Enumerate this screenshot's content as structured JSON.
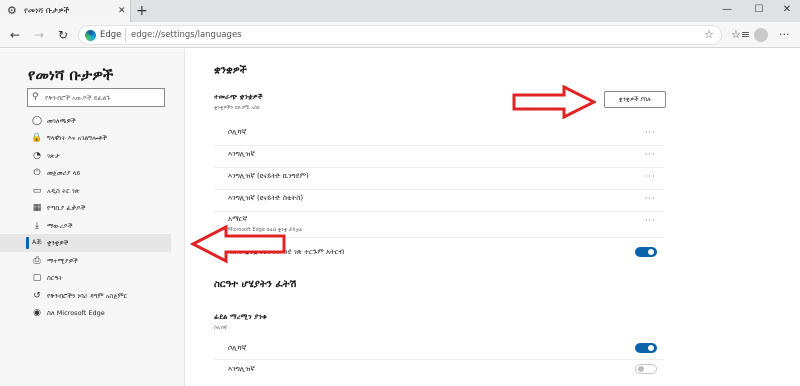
{
  "browser": {
    "tab_title": "የመነሻ ቡታዎች",
    "tab_close_icon": "close-icon",
    "new_tab": "+",
    "window_controls": {
      "minimize": "—",
      "maximize": "☐",
      "close": "✕"
    },
    "nav": {
      "back": "←",
      "forward": "→",
      "refresh": "↻"
    },
    "address_brand": "Edge",
    "address_url": "edge://settings/languages",
    "favorite_icon": "☆",
    "collections_icon": "☆≡",
    "menu_icon": "···"
  },
  "sidebar": {
    "title": "የመነሻ ቡታዎች",
    "search_placeholder": "የቅንብሮች አውዶች ይፈልጉ",
    "items": [
      {
        "icon": "profile-icon",
        "glyph": "◯",
        "label": "መገለጫዎች"
      },
      {
        "icon": "lock-icon",
        "glyph": "🔒",
        "label": "ግላዊነት እና አገልግሎቶች"
      },
      {
        "icon": "appearance-icon",
        "glyph": "◔",
        "label": "ገጽታ"
      },
      {
        "icon": "power-icon",
        "glyph": "⏻",
        "label": "መጀመሪያ ላይ"
      },
      {
        "icon": "newtab-icon",
        "glyph": "▭",
        "label": "አዲስ ትር ገጽ"
      },
      {
        "icon": "site-permissions-icon",
        "glyph": "▦",
        "label": "የጣቢያ ፈቃዶች"
      },
      {
        "icon": "download-icon",
        "glyph": "⤓",
        "label": "ማውረዶች"
      },
      {
        "icon": "languages-icon",
        "glyph": "Aあ",
        "label": "ቋንቋዎች"
      },
      {
        "icon": "printer-icon",
        "glyph": "⎙",
        "label": "ማተሚያዎች"
      },
      {
        "icon": "system-icon",
        "glyph": "▢",
        "label": "ስርዓት"
      },
      {
        "icon": "reset-icon",
        "glyph": "↺",
        "label": "የቅንብሮችን ነባሪ ዳግም አስጀምር"
      },
      {
        "icon": "edge-icon",
        "glyph": "◉",
        "label": "ስለ Microsoft Edge"
      }
    ],
    "selected_index": 7
  },
  "main": {
    "languages_heading": "ቋንቋዎች",
    "preferred_label": "ተመራጭ ቋንቋዎች",
    "preferred_sub": "ቋንቋዎችን በድጋሚ አስከ",
    "add_button": "ቋንቋዎች ያክሉ",
    "languages": [
      {
        "name": "ሶሊሻኛ"
      },
      {
        "name": "እንግሊዝኛ"
      },
      {
        "name": "እንግሊዝኛ (ዩናይትድ ኪንግደም)"
      },
      {
        "name": "እንግሊዝኛ (ዩናይትድ ስቴትስ)"
      },
      {
        "name": "አማርኛ"
      }
    ],
    "amharic_sub": "Microsoft Edge በዚህ ቋንቋ ታይቷል",
    "translate_label": "በምታነቡት ቋንቋ የሆኑትን ወደ ገጽ ተርጉም አትርብ",
    "translate_on": true,
    "spellcheck_heading": "ስርዓተ ሆሄያትን ፈትሽ",
    "spellcheck_label": "ፊደል ማረሚን ያንቁ",
    "spellcheck_sub": "ሶሊሻኛ",
    "spell_languages": [
      {
        "name": "ሶሊሻኛ",
        "on": true
      },
      {
        "name": "እንግሊዝኛ",
        "on": false
      }
    ],
    "more_icon": "···"
  },
  "colors": {
    "accent": "#0a64ad",
    "arrow": "#e02424"
  }
}
